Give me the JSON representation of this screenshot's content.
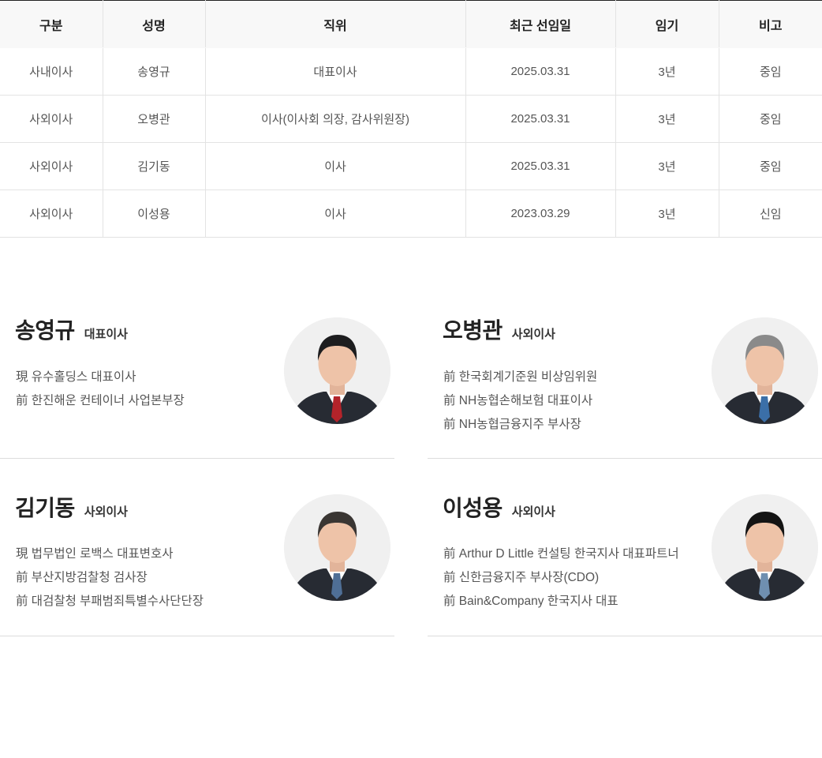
{
  "table": {
    "headers": [
      "구분",
      "성명",
      "직위",
      "최근 선임일",
      "임기",
      "비고"
    ],
    "rows": [
      [
        "사내이사",
        "송영규",
        "대표이사",
        "2025.03.31",
        "3년",
        "중임"
      ],
      [
        "사외이사",
        "오병관",
        "이사(이사회 의장, 감사위원장)",
        "2025.03.31",
        "3년",
        "중임"
      ],
      [
        "사외이사",
        "김기동",
        "이사",
        "2025.03.31",
        "3년",
        "중임"
      ],
      [
        "사외이사",
        "이성용",
        "이사",
        "2023.03.29",
        "3년",
        "신임"
      ]
    ]
  },
  "profiles": [
    {
      "name": "송영규",
      "title": "대표이사",
      "history": [
        "現 유수홀딩스 대표이사",
        "前 한진해운 컨테이너 사업본부장"
      ],
      "photo": "portrait-photo",
      "tie_color": "#b3232a",
      "hair_color": "#1d1d1f"
    },
    {
      "name": "오병관",
      "title": "사외이사",
      "history": [
        "前 한국회계기준원 비상임위원",
        "前 NH농협손해보험 대표이사",
        "前 NH농협금융지주 부사장"
      ],
      "photo": "portrait-photo",
      "tie_color": "#3b6fa8",
      "hair_color": "#8a8a8a"
    },
    {
      "name": "김기동",
      "title": "사외이사",
      "history": [
        "現 법무법인 로백스 대표변호사",
        "前 부산지방검찰청 검사장",
        "前 대검찰청 부패범죄특별수사단단장"
      ],
      "photo": "portrait-photo",
      "tie_color": "#4f6f96",
      "hair_color": "#3a3633"
    },
    {
      "name": "이성용",
      "title": "사외이사",
      "history": [
        "前 Arthur D Little 컨설팅 한국지사 대표파트너",
        "前 신한금융지주 부사장(CDO)",
        "前 Bain&Company 한국지사 대표"
      ],
      "photo": "portrait-photo",
      "tie_color": "#6f8fb0",
      "hair_color": "#141414"
    }
  ]
}
